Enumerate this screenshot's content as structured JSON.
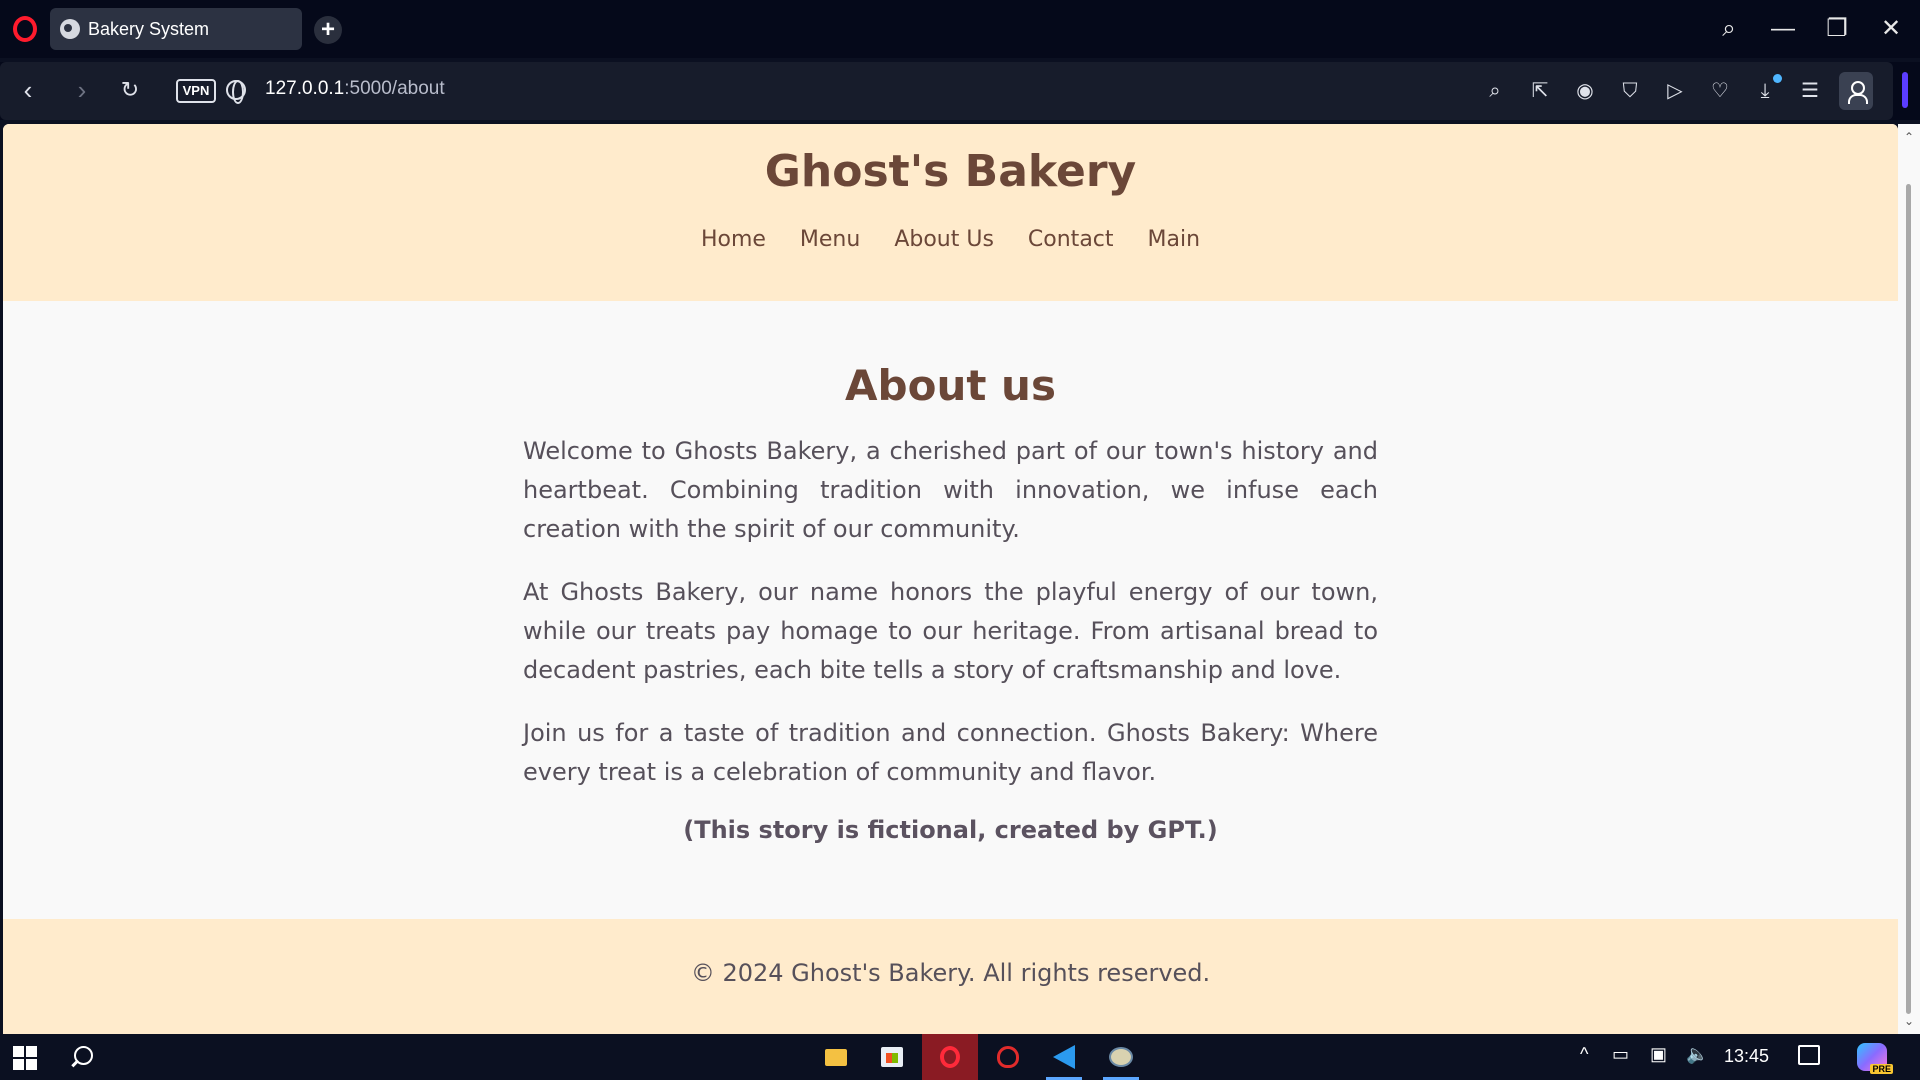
{
  "browser": {
    "tab_title": "Bakery System",
    "new_tab_symbol": "+",
    "url_host": "127.0.0.1",
    "url_rest": ":5000/about",
    "vpn_label": "VPN",
    "back_symbol": "‹",
    "forward_symbol": "›",
    "reload_symbol": "↻",
    "search_symbol": "⌕",
    "minimize_symbol": "—",
    "restore_symbol": "❐",
    "close_symbol": "✕",
    "toolbar_icons": [
      "find-icon",
      "share-icon",
      "camera-icon",
      "shield-icon",
      "send-icon",
      "heart-icon",
      "download-icon",
      "easy-setup-icon",
      "profile-icon"
    ],
    "toolbar_glyphs": [
      "⌕",
      "⇱",
      "◉",
      "⛉",
      "▷",
      "♡",
      "⤓",
      "☰"
    ],
    "accent_color": "#5b3dff"
  },
  "site": {
    "title": "Ghost's Bakery",
    "nav": [
      "Home",
      "Menu",
      "About Us",
      "Contact",
      "Main"
    ],
    "header_bg": "#ffebcc",
    "brand_color": "#6b4738"
  },
  "about": {
    "heading": "About us",
    "paragraphs": [
      "Welcome to Ghosts Bakery, a cherished part of our town's history and heartbeat. Combining tradition with innovation, we infuse each creation with the spirit of our community.",
      "At Ghosts Bakery, our name honors the playful energy of our town, while our treats pay homage to our heritage. From artisanal bread to decadent pastries, each bite tells a story of craftsmanship and love.",
      "Join us for a taste of tradition and connection. Ghosts Bakery: Where every treat is a celebration of community and flavor."
    ],
    "note": "(This story is fictional, created by GPT.)"
  },
  "footer": {
    "text": "© 2024 Ghost's Bakery. All rights reserved."
  },
  "taskbar": {
    "apps": [
      "file-explorer-icon",
      "store-icon",
      "opera-icon",
      "security-icon",
      "vscode-icon",
      "python-icon"
    ],
    "tray_glyphs": [
      "^",
      "▭",
      "▣",
      "🔈"
    ],
    "clock": "13:45",
    "copilot_badge": "PRE"
  }
}
